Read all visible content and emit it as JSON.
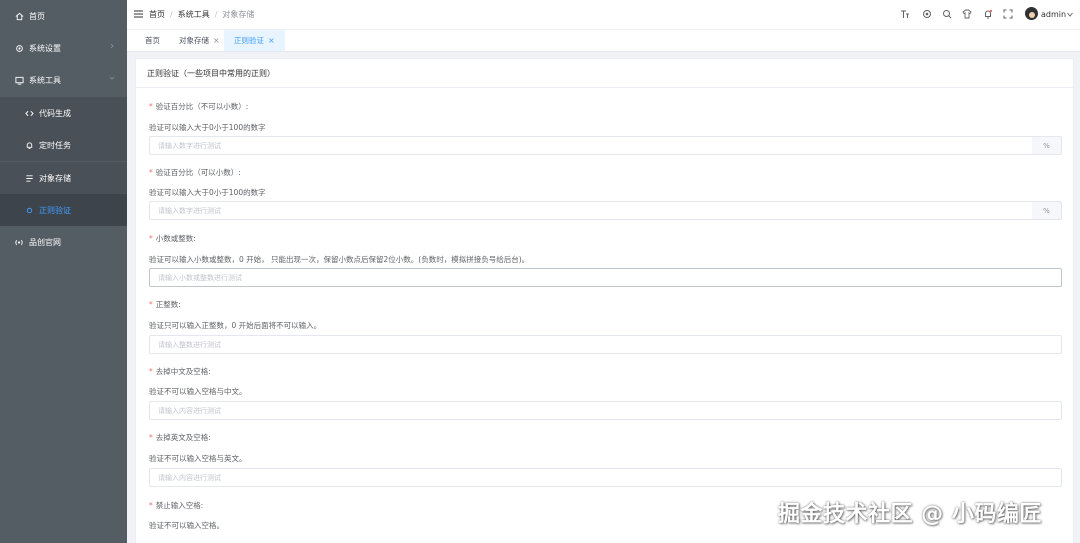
{
  "sidebar": {
    "items": [
      {
        "label": "首页",
        "icon": "home-icon"
      },
      {
        "label": "系统设置",
        "icon": "settings-icon"
      },
      {
        "label": "系统工具",
        "icon": "tools-icon"
      },
      {
        "label": "代码生成",
        "icon": "code-icon"
      },
      {
        "label": "定时任务",
        "icon": "bell-icon"
      },
      {
        "label": "对象存储",
        "icon": "storage-icon"
      },
      {
        "label": "正则验证",
        "icon": "regex-icon"
      },
      {
        "label": "品创官网",
        "icon": "signal-icon"
      }
    ]
  },
  "header": {
    "breadcrumb": [
      "首页",
      "系统工具",
      "对象存储"
    ],
    "username": "admin"
  },
  "tabs": [
    {
      "label": "首页"
    },
    {
      "label": "对象存储"
    },
    {
      "label": "正则验证"
    }
  ],
  "card": {
    "title": "正则验证（一些项目中常用的正则）"
  },
  "fields": [
    {
      "label": "验证百分比（不可以小数）:",
      "desc": "验证可以输入大于0小于100的数字",
      "placeholder": "请输入数字进行测试",
      "append": "%"
    },
    {
      "label": "验证百分比（可以小数）:",
      "desc": "验证可以输入大于0小于100的数字",
      "placeholder": "请输入数字进行测试",
      "append": "%"
    },
    {
      "label": "小数或整数:",
      "desc": "验证可以输入小数或整数，0 开始，  只能出现一次，保留小数点后保留2位小数。(负数时，模拟拼接负号给后台)。",
      "placeholder": "请输入小数或整数进行测试"
    },
    {
      "label": "正整数:",
      "desc": "验证只可以输入正整数，0 开始后面将不可以输入。",
      "placeholder": "请输入整数进行测试"
    },
    {
      "label": "去掉中文及空格:",
      "desc": "验证不可以输入空格与中文。",
      "placeholder": "请输入内容进行测试"
    },
    {
      "label": "去掉英文及空格:",
      "desc": "验证不可以输入空格与英文。",
      "placeholder": "请输入内容进行测试"
    },
    {
      "label": "禁止输入空格:",
      "desc": "验证不可以输入空格。"
    }
  ],
  "watermark": "掘金技术社区 @ 小码编匠",
  "colors": {
    "sidebar_bg": "#545c64",
    "accent": "#409eff",
    "required_star": "#f56c6c"
  }
}
